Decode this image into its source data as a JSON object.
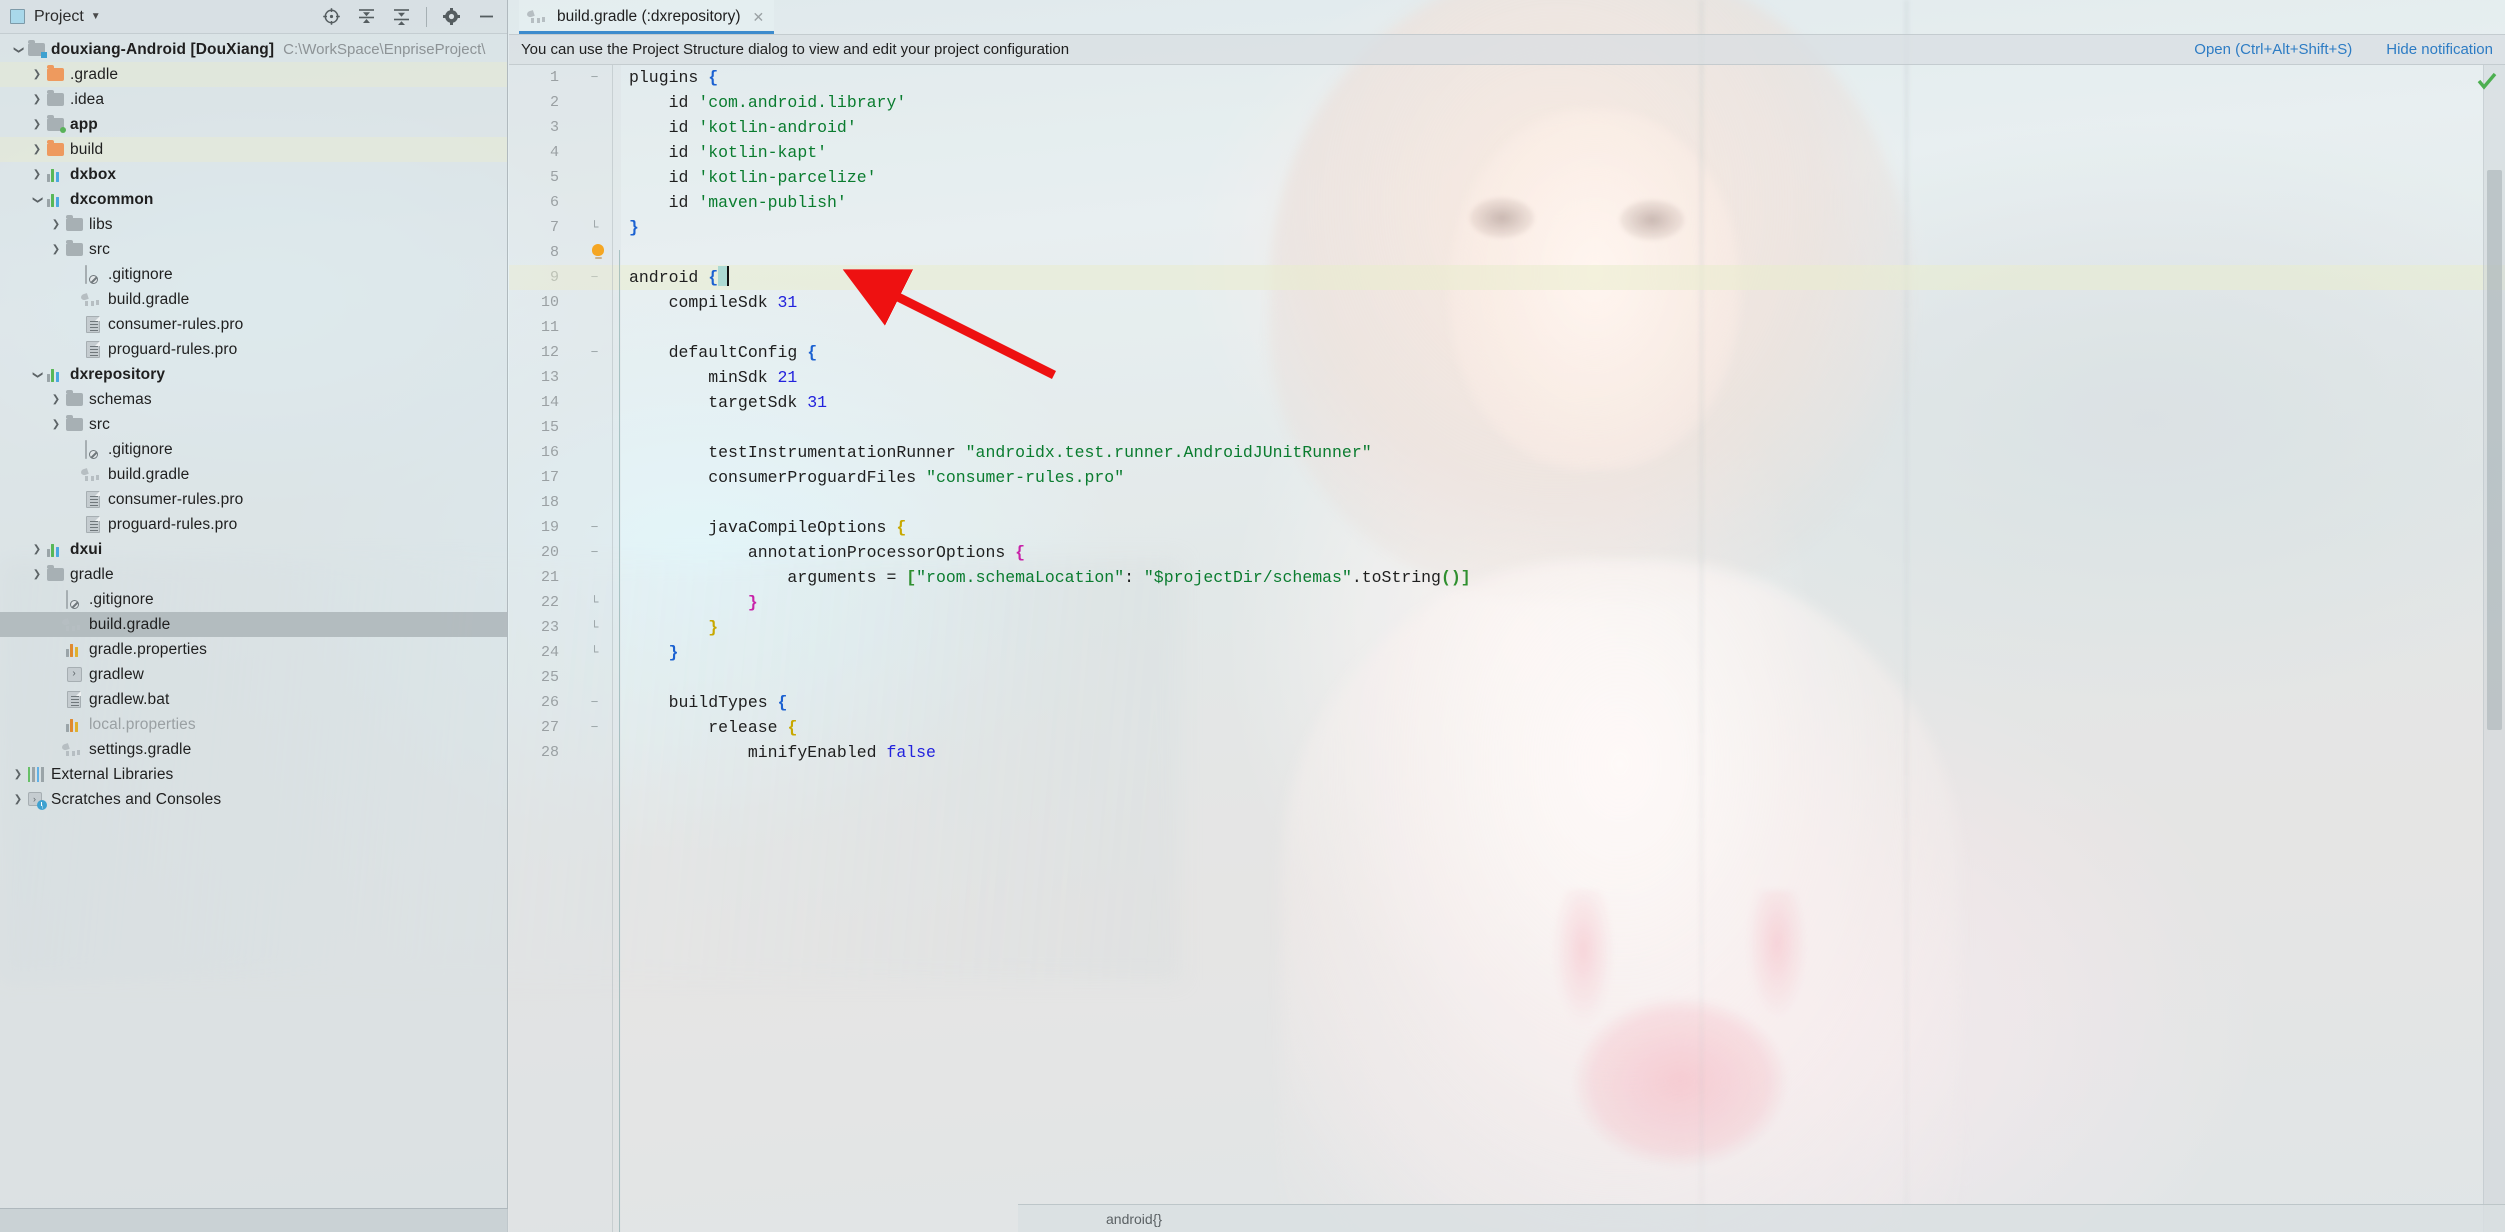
{
  "project_panel": {
    "title": "Project",
    "title_icon": "project-window-icon",
    "caret_icon": "chevron-down-icon",
    "toolbar": [
      {
        "name": "select-opened-file-icon",
        "label": "Select Opened File"
      },
      {
        "name": "expand-all-icon",
        "label": "Expand All"
      },
      {
        "name": "collapse-all-icon",
        "label": "Collapse All"
      },
      {
        "name": "settings-gear-icon",
        "label": "Settings"
      },
      {
        "name": "hide-panel-icon",
        "label": "Hide"
      }
    ],
    "tree": [
      {
        "label": "douxiang-Android",
        "badge": "[DouXiang]",
        "sub": "C:\\WorkSpace\\EnpriseProject\\",
        "icon": "module-folder-icon",
        "indent": 0,
        "arrow": "open",
        "bold": true
      },
      {
        "label": ".gradle",
        "icon": "folder-orange-icon",
        "indent": 1,
        "arrow": "closed",
        "band": true
      },
      {
        "label": ".idea",
        "icon": "folder-icon",
        "indent": 1,
        "arrow": "closed"
      },
      {
        "label": "app",
        "icon": "folder-source-icon",
        "indent": 1,
        "arrow": "closed",
        "bold": true
      },
      {
        "label": "build",
        "icon": "folder-orange-icon",
        "indent": 1,
        "arrow": "closed",
        "band": true
      },
      {
        "label": "dxbox",
        "icon": "module-icon",
        "indent": 1,
        "arrow": "closed",
        "bold": true
      },
      {
        "label": "dxcommon",
        "icon": "module-icon",
        "indent": 1,
        "arrow": "open",
        "bold": true
      },
      {
        "label": "libs",
        "icon": "folder-icon",
        "indent": 2,
        "arrow": "closed"
      },
      {
        "label": "src",
        "icon": "folder-icon",
        "indent": 2,
        "arrow": "closed"
      },
      {
        "label": ".gitignore",
        "icon": "gitignore-file-icon",
        "indent": 3,
        "arrow": "none"
      },
      {
        "label": "build.gradle",
        "icon": "gradle-file-icon",
        "indent": 3,
        "arrow": "none"
      },
      {
        "label": "consumer-rules.pro",
        "icon": "text-file-icon",
        "indent": 3,
        "arrow": "none"
      },
      {
        "label": "proguard-rules.pro",
        "icon": "text-file-icon",
        "indent": 3,
        "arrow": "none"
      },
      {
        "label": "dxrepository",
        "icon": "module-icon",
        "indent": 1,
        "arrow": "open",
        "bold": true
      },
      {
        "label": "schemas",
        "icon": "folder-icon",
        "indent": 2,
        "arrow": "closed"
      },
      {
        "label": "src",
        "icon": "folder-icon",
        "indent": 2,
        "arrow": "closed"
      },
      {
        "label": ".gitignore",
        "icon": "gitignore-file-icon",
        "indent": 3,
        "arrow": "none"
      },
      {
        "label": "build.gradle",
        "icon": "gradle-file-icon",
        "indent": 3,
        "arrow": "none"
      },
      {
        "label": "consumer-rules.pro",
        "icon": "text-file-icon",
        "indent": 3,
        "arrow": "none"
      },
      {
        "label": "proguard-rules.pro",
        "icon": "text-file-icon",
        "indent": 3,
        "arrow": "none"
      },
      {
        "label": "dxui",
        "icon": "module-icon",
        "indent": 1,
        "arrow": "closed",
        "bold": true
      },
      {
        "label": "gradle",
        "icon": "folder-icon",
        "indent": 1,
        "arrow": "closed"
      },
      {
        "label": ".gitignore",
        "icon": "gitignore-file-icon",
        "indent": 2,
        "arrow": "none"
      },
      {
        "label": "build.gradle",
        "icon": "gradle-file-icon",
        "indent": 2,
        "arrow": "none",
        "selected": true
      },
      {
        "label": "gradle.properties",
        "icon": "properties-file-icon",
        "indent": 2,
        "arrow": "none"
      },
      {
        "label": "gradlew",
        "icon": "shell-file-icon",
        "indent": 2,
        "arrow": "none"
      },
      {
        "label": "gradlew.bat",
        "icon": "text-file-icon",
        "indent": 2,
        "arrow": "none"
      },
      {
        "label": "local.properties",
        "icon": "properties-file-icon",
        "indent": 2,
        "arrow": "none",
        "dim": true
      },
      {
        "label": "settings.gradle",
        "icon": "gradle-file-icon",
        "indent": 2,
        "arrow": "none"
      },
      {
        "label": "External Libraries",
        "icon": "external-libraries-icon",
        "indent": 0,
        "arrow": "closed"
      },
      {
        "label": "Scratches and Consoles",
        "icon": "scratches-icon",
        "indent": 0,
        "arrow": "closed"
      }
    ]
  },
  "editor": {
    "tab": {
      "label": "build.gradle (:dxrepository)",
      "icon": "gradle-file-icon",
      "close_icon": "close-icon"
    },
    "notification": {
      "text": "You can use the Project Structure dialog to view and edit your project configuration",
      "open_link": "Open (Ctrl+Alt+Shift+S)",
      "hide_link": "Hide notification"
    },
    "inspection_status_icon": "checkmark-ok-icon",
    "breadcrumb": "android{}",
    "caret_line": 9,
    "lines": [
      {
        "n": 1,
        "fold": "minus",
        "tokens": [
          [
            "k",
            "plugins "
          ],
          [
            "b1",
            "{"
          ]
        ]
      },
      {
        "n": 2,
        "fold": "",
        "tokens": [
          [
            "k",
            "    id "
          ],
          [
            "s",
            "'com.android.library'"
          ]
        ]
      },
      {
        "n": 3,
        "fold": "",
        "tokens": [
          [
            "k",
            "    id "
          ],
          [
            "s",
            "'kotlin-android'"
          ]
        ]
      },
      {
        "n": 4,
        "fold": "",
        "tokens": [
          [
            "k",
            "    id "
          ],
          [
            "s",
            "'kotlin-kapt'"
          ]
        ]
      },
      {
        "n": 5,
        "fold": "",
        "tokens": [
          [
            "k",
            "    id "
          ],
          [
            "s",
            "'kotlin-parcelize'"
          ]
        ]
      },
      {
        "n": 6,
        "fold": "",
        "tokens": [
          [
            "k",
            "    id "
          ],
          [
            "s",
            "'maven-publish'"
          ]
        ]
      },
      {
        "n": 7,
        "fold": "end",
        "tokens": [
          [
            "b1",
            "}"
          ]
        ]
      },
      {
        "n": 8,
        "fold": "",
        "tokens": []
      },
      {
        "n": 9,
        "fold": "minus",
        "tokens": [
          [
            "k",
            "android "
          ],
          [
            "b1",
            "{"
          ]
        ],
        "highlight": true,
        "caret": true
      },
      {
        "n": 10,
        "fold": "",
        "tokens": [
          [
            "k",
            "    compileSdk "
          ],
          [
            "n",
            "31"
          ]
        ]
      },
      {
        "n": 11,
        "fold": "",
        "tokens": []
      },
      {
        "n": 12,
        "fold": "minus",
        "tokens": [
          [
            "k",
            "    defaultConfig "
          ],
          [
            "b1",
            "{"
          ]
        ]
      },
      {
        "n": 13,
        "fold": "",
        "tokens": [
          [
            "k",
            "        minSdk "
          ],
          [
            "n",
            "21"
          ]
        ]
      },
      {
        "n": 14,
        "fold": "",
        "tokens": [
          [
            "k",
            "        targetSdk "
          ],
          [
            "n",
            "31"
          ]
        ]
      },
      {
        "n": 15,
        "fold": "",
        "tokens": []
      },
      {
        "n": 16,
        "fold": "",
        "tokens": [
          [
            "k",
            "        testInstrumentationRunner "
          ],
          [
            "s",
            "\"androidx.test.runner.AndroidJUnitRunner\""
          ]
        ]
      },
      {
        "n": 17,
        "fold": "",
        "tokens": [
          [
            "k",
            "        consumerProguardFiles "
          ],
          [
            "s",
            "\"consumer-rules.pro\""
          ]
        ]
      },
      {
        "n": 18,
        "fold": "",
        "tokens": []
      },
      {
        "n": 19,
        "fold": "minus",
        "tokens": [
          [
            "k",
            "        javaCompileOptions "
          ],
          [
            "b2",
            "{"
          ]
        ]
      },
      {
        "n": 20,
        "fold": "minus",
        "tokens": [
          [
            "k",
            "            annotationProcessorOptions "
          ],
          [
            "b3",
            "{"
          ]
        ]
      },
      {
        "n": 21,
        "fold": "",
        "tokens": [
          [
            "k",
            "                arguments = "
          ],
          [
            "b4",
            "["
          ],
          [
            "s",
            "\"room.schemaLocation\""
          ],
          [
            "k",
            ": "
          ],
          [
            "s",
            "\"$projectDir/schemas\""
          ],
          [
            "k",
            ".toString"
          ],
          [
            "b4",
            "()]"
          ]
        ]
      },
      {
        "n": 22,
        "fold": "end",
        "tokens": [
          [
            "k",
            "            "
          ],
          [
            "b3",
            "}"
          ]
        ]
      },
      {
        "n": 23,
        "fold": "end",
        "tokens": [
          [
            "k",
            "        "
          ],
          [
            "b2",
            "}"
          ]
        ]
      },
      {
        "n": 24,
        "fold": "end",
        "tokens": [
          [
            "k",
            "    "
          ],
          [
            "b1",
            "}"
          ]
        ]
      },
      {
        "n": 25,
        "fold": "",
        "tokens": []
      },
      {
        "n": 26,
        "fold": "minus",
        "tokens": [
          [
            "k",
            "    buildTypes "
          ],
          [
            "b1",
            "{"
          ]
        ]
      },
      {
        "n": 27,
        "fold": "minus",
        "tokens": [
          [
            "k",
            "        release "
          ],
          [
            "b2",
            "{"
          ]
        ]
      },
      {
        "n": 28,
        "fold": "",
        "tokens": [
          [
            "k",
            "            minifyEnabled "
          ],
          [
            "n",
            "false"
          ]
        ]
      }
    ]
  },
  "annotation": {
    "arrow_icon": "red-arrow-annotation",
    "color": "#ee1111"
  },
  "colors": {
    "accent": "#3d8bcd",
    "link": "#2d7cc4",
    "string": "#0a7c2f",
    "number": "#2222dd",
    "highlight_line": "#e9ecce",
    "selection": "#b0b8bc",
    "ok": "#4caf50"
  }
}
